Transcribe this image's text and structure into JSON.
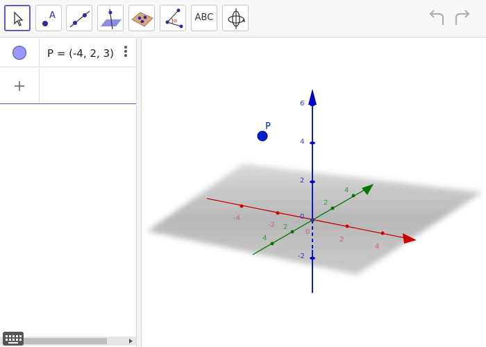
{
  "toolbar": {
    "tools": [
      {
        "name": "move-tool",
        "icon": "cursor-arrow-icon"
      },
      {
        "name": "point-tool",
        "icon": "point-A-icon"
      },
      {
        "name": "line-tool",
        "icon": "line-through-points-icon"
      },
      {
        "name": "perpendicular-plane-tool",
        "icon": "plane-line-icon"
      },
      {
        "name": "polygon-tool",
        "icon": "polygon-points-icon"
      },
      {
        "name": "angle-tool",
        "icon": "angle-alpha-icon"
      },
      {
        "name": "text-tool",
        "label": "ABC"
      },
      {
        "name": "rotate-view-tool",
        "icon": "rotate-3d-icon"
      }
    ],
    "undo_icon": "undo-icon",
    "redo_icon": "redo-icon",
    "selected_color": "#6557d2"
  },
  "algebra": {
    "object_label": "P = (-4, 2, 3)",
    "marble_color": "#9999ff",
    "input_placeholder": "",
    "add_icon": "plus-icon",
    "menu_icon": "vertical-dots-icon"
  },
  "graphics": {
    "point": {
      "name": "P",
      "x": -4,
      "y": 2,
      "z": 3,
      "color": "#0000cc"
    },
    "axes": {
      "x": {
        "color": "#cc0000",
        "ticks": [
          "-4",
          "-2",
          "0",
          "2",
          "4"
        ]
      },
      "y": {
        "color": "#007700",
        "ticks": [
          "4",
          "2",
          "2",
          "4"
        ]
      },
      "z": {
        "color": "#0000cc",
        "ticks": [
          "6",
          "4",
          "2",
          "0",
          "-2"
        ]
      }
    }
  },
  "keyboard_icon": "keyboard-icon"
}
